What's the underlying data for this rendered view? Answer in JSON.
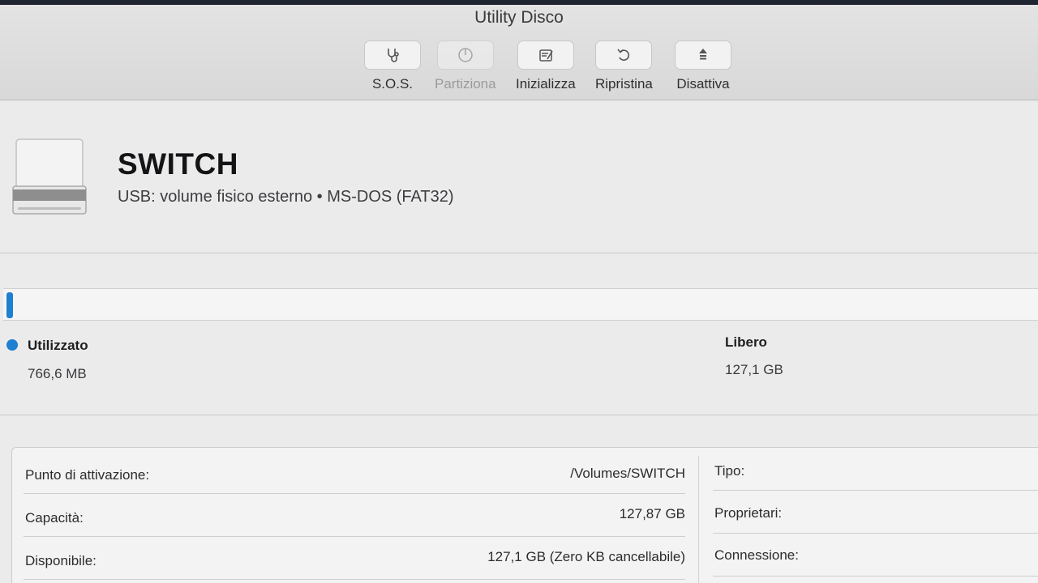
{
  "window": {
    "title": "Utility Disco"
  },
  "toolbar": {
    "sos": {
      "label": "S.O.S.",
      "icon": "stethoscope-icon"
    },
    "partition": {
      "label": "Partiziona",
      "icon": "partition-pie-icon"
    },
    "erase": {
      "label": "Inizializza",
      "icon": "erase-disk-icon"
    },
    "restore": {
      "label": "Ripristina",
      "icon": "restore-arrow-icon"
    },
    "unmount": {
      "label": "Disattiva",
      "icon": "unmount-icon"
    }
  },
  "volume": {
    "name": "SWITCH",
    "description": "USB: volume fisico esterno • MS-DOS (FAT32)",
    "icon": "external-drive-icon"
  },
  "usage": {
    "used_label": "Utilizzato",
    "used_value": "766,6 MB",
    "free_label": "Libero",
    "free_value": "127,1 GB",
    "used_fraction": 0.006,
    "used_color": "#1f7fd0"
  },
  "info": {
    "mount_point": {
      "label": "Punto di attivazione:",
      "value": "/Volumes/SWITCH"
    },
    "capacity": {
      "label": "Capacità:",
      "value": "127,87 GB"
    },
    "available": {
      "label": "Disponibile:",
      "value": "127,1 GB (Zero KB cancellabile)"
    },
    "type": {
      "label": "Tipo:"
    },
    "owners": {
      "label": "Proprietari:"
    },
    "connection": {
      "label": "Connessione:"
    }
  }
}
